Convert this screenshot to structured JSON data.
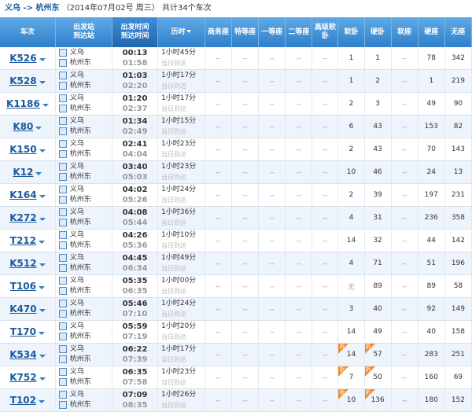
{
  "header": {
    "route": "义乌 -> 杭州东",
    "date": "（2014年07月02号  周三）",
    "total": "共计34个车次"
  },
  "columns": {
    "train": "车次",
    "station_top": "出发站",
    "station_bottom": "到达站",
    "time_top": "出发时间",
    "time_bottom": "到达时间",
    "duration": "历时",
    "seats": [
      "商务座",
      "特等座",
      "一等座",
      "二等座",
      "高级软卧",
      "软卧",
      "硬卧",
      "软座",
      "硬座",
      "无座"
    ]
  },
  "duration_note": "当日到达",
  "discount_label": "折",
  "rows": [
    {
      "train": "K526",
      "from": "义乌",
      "to": "杭州东",
      "dep": "00:13",
      "arr": "01:58",
      "dur": "1小时45分",
      "seats": [
        "--",
        "--",
        "--",
        "--",
        "--",
        "1",
        "1",
        "--",
        "78",
        "342"
      ],
      "disc": []
    },
    {
      "train": "K528",
      "from": "义乌",
      "to": "杭州东",
      "dep": "01:03",
      "arr": "02:20",
      "dur": "1小时17分",
      "seats": [
        "--",
        "--",
        "--",
        "--",
        "--",
        "1",
        "2",
        "--",
        "1",
        "219"
      ],
      "disc": []
    },
    {
      "train": "K1186",
      "from": "义乌",
      "to": "杭州东",
      "dep": "01:20",
      "arr": "02:37",
      "dur": "1小时17分",
      "seats": [
        "--",
        "--",
        "--",
        "--",
        "--",
        "2",
        "3",
        "--",
        "49",
        "90"
      ],
      "disc": []
    },
    {
      "train": "K80",
      "from": "义乌",
      "to": "杭州东",
      "dep": "01:34",
      "arr": "02:49",
      "dur": "1小时15分",
      "seats": [
        "--",
        "--",
        "--",
        "--",
        "--",
        "6",
        "43",
        "--",
        "153",
        "82"
      ],
      "disc": []
    },
    {
      "train": "K150",
      "from": "义乌",
      "to": "杭州东",
      "dep": "02:41",
      "arr": "04:04",
      "dur": "1小时23分",
      "seats": [
        "--",
        "--",
        "--",
        "--",
        "--",
        "2",
        "43",
        "--",
        "70",
        "143"
      ],
      "disc": []
    },
    {
      "train": "K12",
      "from": "义乌",
      "to": "杭州东",
      "dep": "03:40",
      "arr": "05:03",
      "dur": "1小时23分",
      "seats": [
        "--",
        "--",
        "--",
        "--",
        "--",
        "10",
        "46",
        "--",
        "24",
        "13"
      ],
      "disc": []
    },
    {
      "train": "K164",
      "from": "义乌",
      "to": "杭州东",
      "dep": "04:02",
      "arr": "05:26",
      "dur": "1小时24分",
      "seats": [
        "--",
        "--",
        "--",
        "--",
        "--",
        "2",
        "39",
        "--",
        "197",
        "231"
      ],
      "disc": []
    },
    {
      "train": "K272",
      "from": "义乌",
      "to": "杭州东",
      "dep": "04:08",
      "arr": "05:44",
      "dur": "1小时36分",
      "seats": [
        "--",
        "--",
        "--",
        "--",
        "--",
        "4",
        "31",
        "--",
        "236",
        "358"
      ],
      "disc": []
    },
    {
      "train": "T212",
      "from": "义乌",
      "to": "杭州东",
      "dep": "04:26",
      "arr": "05:36",
      "dur": "1小时10分",
      "seats": [
        "--",
        "--",
        "--",
        "--",
        "--",
        "14",
        "32",
        "--",
        "44",
        "142"
      ],
      "disc": []
    },
    {
      "train": "K512",
      "from": "义乌",
      "to": "杭州东",
      "dep": "04:45",
      "arr": "06:34",
      "dur": "1小时49分",
      "seats": [
        "--",
        "--",
        "--",
        "--",
        "--",
        "4",
        "71",
        "--",
        "51",
        "196"
      ],
      "disc": []
    },
    {
      "train": "T106",
      "from": "义乌",
      "to": "杭州东",
      "dep": "05:35",
      "arr": "06:35",
      "dur": "1小时00分",
      "seats": [
        "--",
        "--",
        "--",
        "--",
        "--",
        "无",
        "89",
        "--",
        "89",
        "58"
      ],
      "disc": []
    },
    {
      "train": "K470",
      "from": "义乌",
      "to": "杭州东",
      "dep": "05:46",
      "arr": "07:10",
      "dur": "1小时24分",
      "seats": [
        "--",
        "--",
        "--",
        "--",
        "--",
        "3",
        "40",
        "--",
        "92",
        "149"
      ],
      "disc": []
    },
    {
      "train": "T170",
      "from": "义乌",
      "to": "杭州东",
      "dep": "05:59",
      "arr": "07:19",
      "dur": "1小时20分",
      "seats": [
        "--",
        "--",
        "--",
        "--",
        "--",
        "14",
        "49",
        "--",
        "40",
        "158"
      ],
      "disc": []
    },
    {
      "train": "K534",
      "from": "义乌",
      "to": "杭州东",
      "dep": "06:22",
      "arr": "07:39",
      "dur": "1小时17分",
      "seats": [
        "--",
        "--",
        "--",
        "--",
        "--",
        "14",
        "57",
        "--",
        "283",
        "251"
      ],
      "disc": [
        5,
        6
      ]
    },
    {
      "train": "K752",
      "from": "义乌",
      "to": "杭州东",
      "dep": "06:35",
      "arr": "07:58",
      "dur": "1小时23分",
      "seats": [
        "--",
        "--",
        "--",
        "--",
        "--",
        "7",
        "50",
        "--",
        "160",
        "69"
      ],
      "disc": [
        5,
        6
      ]
    },
    {
      "train": "T102",
      "from": "义乌",
      "to": "杭州东",
      "dep": "07:09",
      "arr": "08:35",
      "dur": "1小时26分",
      "seats": [
        "--",
        "--",
        "--",
        "--",
        "--",
        "10",
        "136",
        "--",
        "180",
        "152"
      ],
      "disc": [
        5,
        6
      ]
    }
  ]
}
